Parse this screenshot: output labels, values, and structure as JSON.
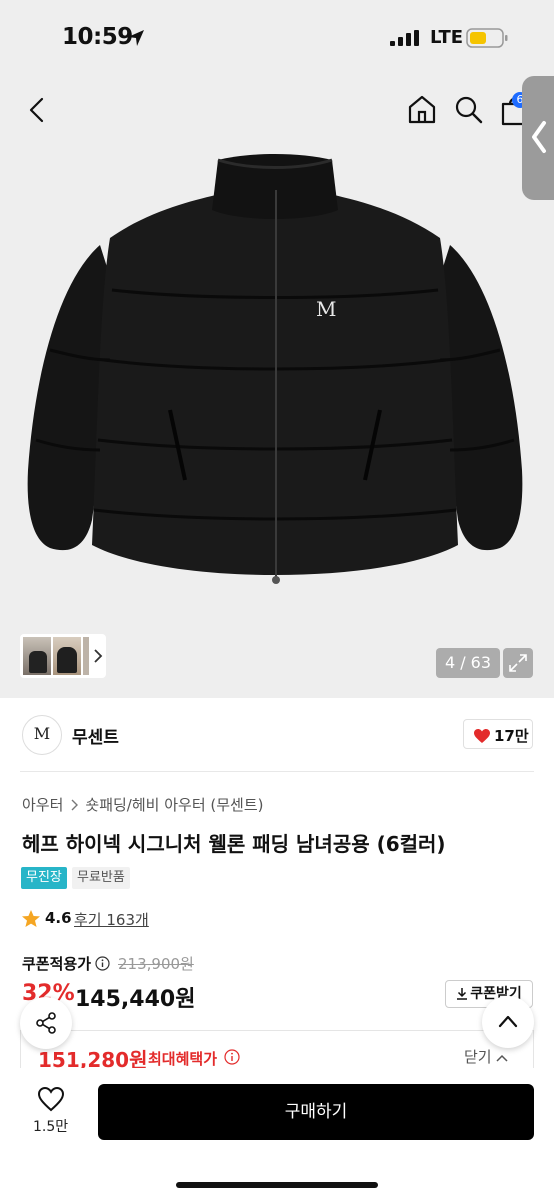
{
  "status_bar": {
    "time": "10:59",
    "network": "LTE"
  },
  "nav": {
    "cart_badge": "6"
  },
  "gallery": {
    "counter": "4 / 63"
  },
  "brand": {
    "logo_text": "M",
    "name": "무센트",
    "likes": "17만"
  },
  "breadcrumb": {
    "items": [
      "아우터",
      "숏패딩/헤비 아우터 (무센트)"
    ]
  },
  "product": {
    "title": "헤프 하이넥 시그니처 웰론 패딩 남녀공용 (6컬러)",
    "tags": [
      "무진장",
      "무료반품"
    ],
    "rating": "4.6",
    "reviews": "후기 163개"
  },
  "price": {
    "coupon_label": "쿠폰적용가",
    "original": "213,900원",
    "discount": "32%",
    "final": "145,440원",
    "coupon_button": "쿠폰받기"
  },
  "benefit": {
    "price": "151,280원",
    "label": "최대혜택가",
    "close": "닫기"
  },
  "bottom_bar": {
    "wish_count": "1.5만",
    "buy_label": "구매하기"
  },
  "colors": {
    "accent_red": "#e32b2b",
    "tag_blue": "#27b5c8",
    "badge_blue": "#1d6bff"
  }
}
